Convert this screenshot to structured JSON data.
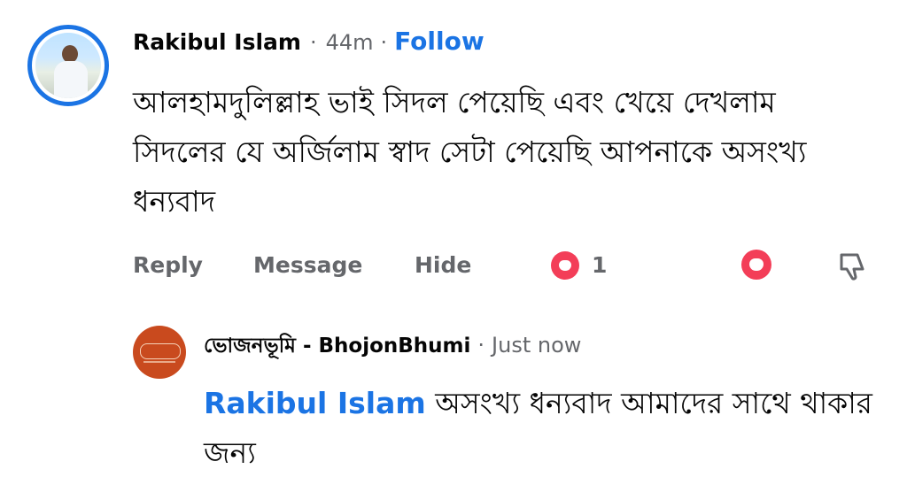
{
  "comment": {
    "author": "Rakibul Islam",
    "time": "44m",
    "separator": "·",
    "follow_label": "Follow",
    "text": "আলহামদুলিল্লাহ ভাই সিদল পেয়েছি এবং খেয়ে দেখলাম সিদলের যে অর্জিলাম স্বাদ সেটা পেয়েছি আপনাকে অসংখ্য ধন্যবাদ",
    "actions": {
      "reply_label": "Reply",
      "message_label": "Message",
      "hide_label": "Hide",
      "reaction_count": "1"
    },
    "icons": {
      "reaction": "love-reaction-icon",
      "react_button": "love-react-icon",
      "dislike": "thumbs-down-icon"
    }
  },
  "reply": {
    "author": "ভোজনভূমি - BhojonBhumi",
    "separator": "·",
    "time": "Just now",
    "mention": "Rakibul Islam",
    "text": "অসংখ্য ধন্যবাদ আমাদের সাথে থাকার জন্য"
  },
  "colors": {
    "accent": "#1b74e4",
    "love": "#f33e58",
    "secondary_text": "#65676b",
    "page_avatar": "#c94a1e"
  }
}
